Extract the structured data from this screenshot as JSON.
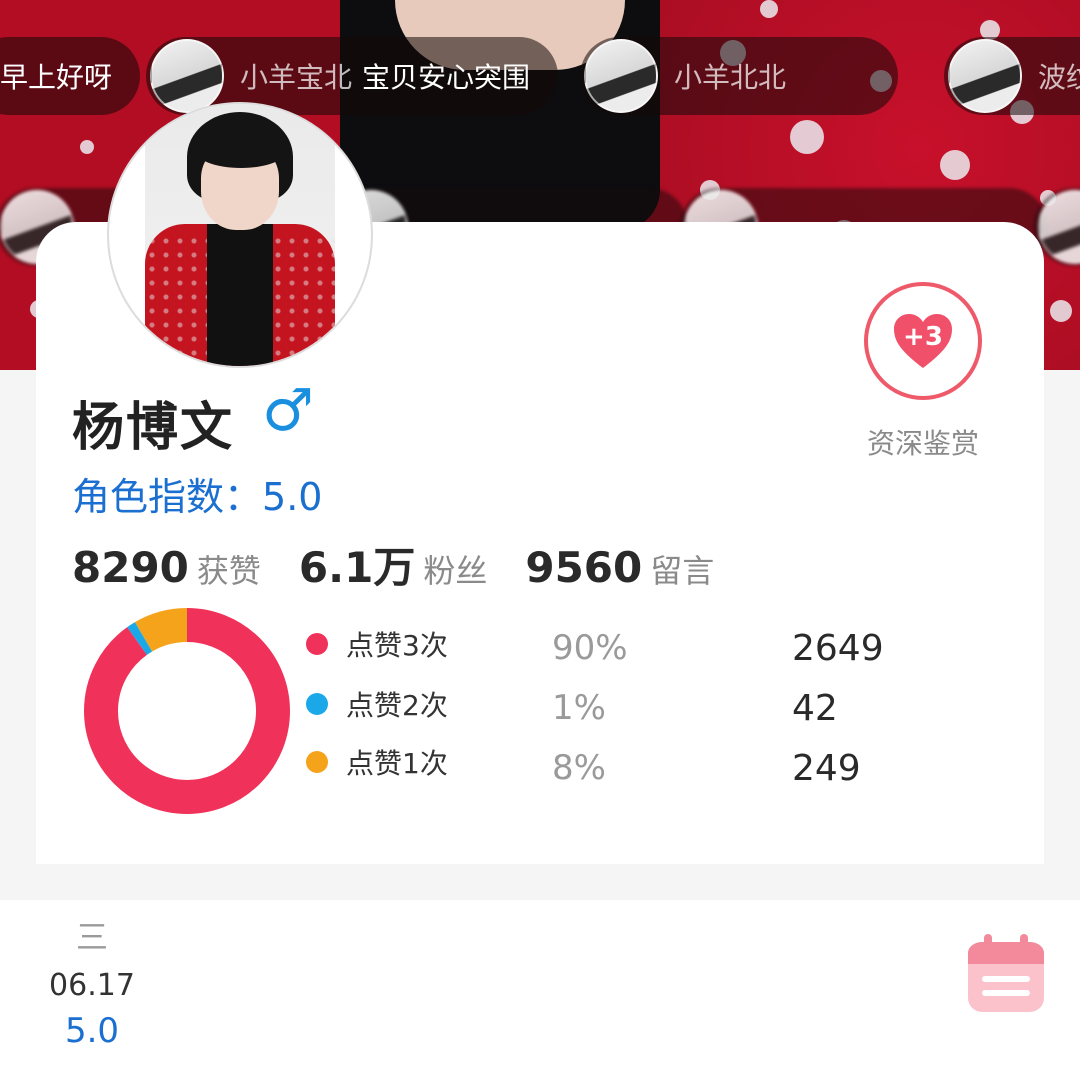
{
  "danmu": [
    {
      "name": "",
      "text": "早上好呀"
    },
    {
      "name": "小羊宝北",
      "text": "宝贝安心突围"
    },
    {
      "name": "小羊北北",
      "text": ""
    },
    {
      "name": "波纹",
      "text": ""
    }
  ],
  "profile": {
    "name": "杨博文",
    "gender_symbol": "♂",
    "index_label": "角色指数：",
    "index_value": "5.0",
    "stats": [
      {
        "value": "8290",
        "label": "获赞"
      },
      {
        "value": "6.1万",
        "label": "粉丝"
      },
      {
        "value": "9560",
        "label": "留言"
      }
    ]
  },
  "like_badge": {
    "value": "+3",
    "label": "资深鉴赏"
  },
  "chart_data": {
    "type": "pie",
    "style": "donut",
    "categories": [
      "点赞3次",
      "点赞2次",
      "点赞1次"
    ],
    "values": [
      2649,
      42,
      249
    ],
    "percent_labels": [
      "90%",
      "1%",
      "8%"
    ],
    "colors": [
      "#f0325a",
      "#1aa8e8",
      "#f5a31a"
    ],
    "legend": "right"
  },
  "bottom_bar": {
    "weekday": "三",
    "date": "06.17",
    "score": "5.0",
    "calendar_icon": "calendar-icon"
  },
  "colors": {
    "accent_blue": "#1a6fd0",
    "gender_blue": "#1a8fe0",
    "like_red": "#ef5a6b"
  }
}
